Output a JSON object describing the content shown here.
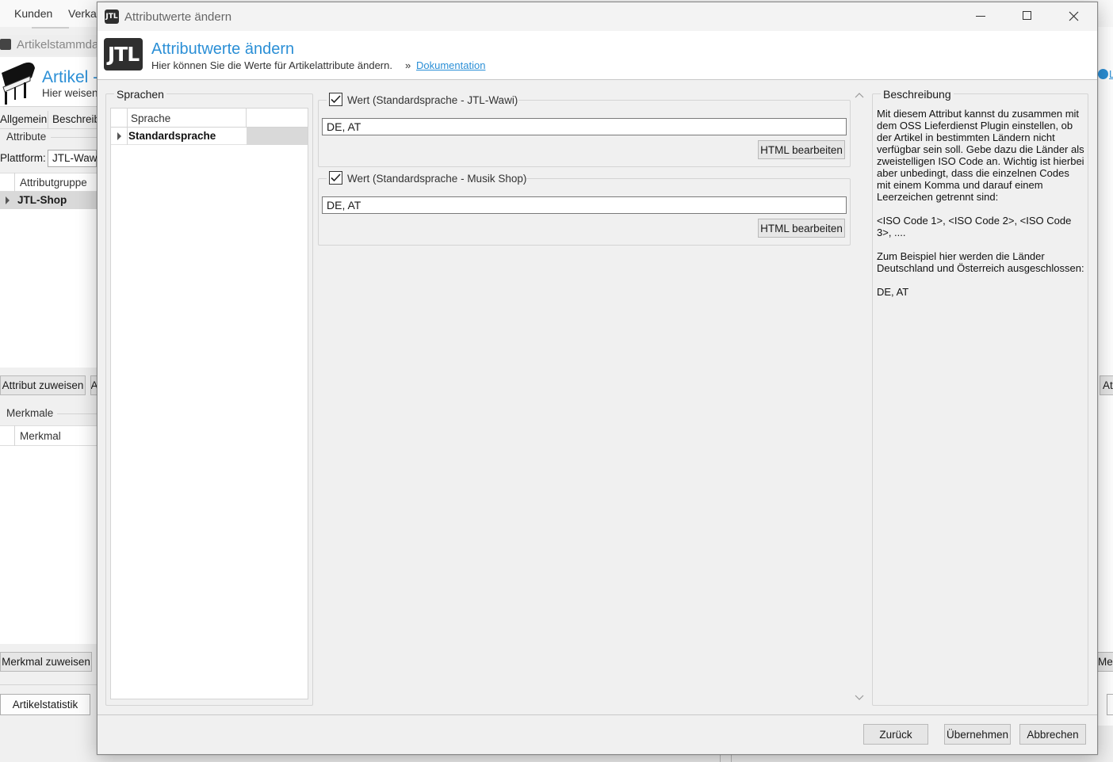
{
  "background": {
    "menu": [
      "Kunden",
      "Verka"
    ],
    "window_title": "Artikelstammda",
    "page_title": "Artikel -",
    "page_subtitle": "Hier weisen",
    "tabs": [
      "Allgemein",
      "Beschreib"
    ],
    "attribute_section": "Attribute",
    "platform_label": "Plattform:",
    "platform_value": "JTL-Waw",
    "attr_col_header": "Attributgruppe",
    "attr_row": "JTL-Shop",
    "assign_attribute_button": "Attribut zuweisen",
    "assign_attribute_button2": "A",
    "merkmale_section": "Merkmale",
    "merkmal_col_header": "Merkmal",
    "assign_merkmal_button": "Merkmal zuweisen",
    "stats_button": "Artikelstatistik",
    "right_partial_btn1": "At",
    "right_partial_btn2": "Mer",
    "right_partial_link": "L"
  },
  "dialog": {
    "title": "Attributwerte ändern",
    "logo_text": "JTL",
    "header_title": "Attributwerte ändern",
    "header_subtitle": "Hier können Sie die Werte für Artikelattribute ändern.",
    "header_separator": "»",
    "doc_link": "Dokumentation",
    "languages": {
      "group_label": "Sprachen",
      "col_header": "Sprache",
      "rows": [
        "Standardsprache"
      ]
    },
    "values": [
      {
        "label": "Wert (Standardsprache - JTL-Wawi)",
        "checked": true,
        "value": "DE, AT",
        "button": "HTML bearbeiten"
      },
      {
        "label": "Wert (Standardsprache - Musik Shop)",
        "checked": true,
        "value": "DE, AT",
        "button": "HTML bearbeiten"
      }
    ],
    "description": {
      "group_label": "Beschreibung",
      "paragraphs": [
        "Mit diesem Attribut kannst du zusammen mit dem OSS Lieferdienst Plugin einstellen, ob der Artikel in bestimmten Ländern nicht verfügbar sein soll. Gebe dazu die Länder als zweistelligen ISO Code an. Wichtig ist hierbei aber unbedingt, dass die einzelnen Codes mit einem Komma und darauf einem Leerzeichen getrennt sind:",
        "<ISO Code 1>, <ISO Code 2>, <ISO Code 3>, ....",
        "Zum Beispiel hier werden die Länder Deutschland und Österreich ausgeschlossen:",
        "DE, AT"
      ]
    },
    "footer": {
      "back": "Zurück",
      "apply": "Übernehmen",
      "cancel": "Abbrechen"
    }
  }
}
